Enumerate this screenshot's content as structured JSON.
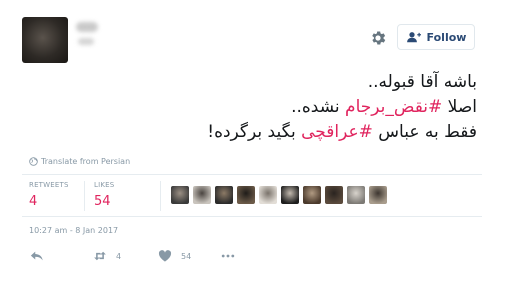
{
  "header": {
    "follow_label": "Follow"
  },
  "tweet": {
    "lines": [
      [
        {
          "text": "باشه آقا قبوله..",
          "hashtag": false
        }
      ],
      [
        {
          "text": "اصلا ",
          "hashtag": false
        },
        {
          "text": "#نقض_برجام",
          "hashtag": true
        },
        {
          "text": " نشده..",
          "hashtag": false
        }
      ],
      [
        {
          "text": "فقط به عباس ",
          "hashtag": false
        },
        {
          "text": "#عراقچی",
          "hashtag": true
        },
        {
          "text": " بگید برگرده!",
          "hashtag": false
        }
      ]
    ],
    "translate_label": "Translate from Persian"
  },
  "stats": {
    "retweets_label": "RETWEETS",
    "retweets_value": "4",
    "likes_label": "LIKES",
    "likes_value": "54"
  },
  "timestamp": "10:27 am - 8 Jan 2017",
  "actions": {
    "retweet_count": "4",
    "like_count": "54"
  },
  "colors": {
    "accent": "#e0245e",
    "muted": "#8899a6",
    "follow_text": "#2b4a75"
  },
  "liker_avatars": [
    {
      "name": "liker-avatar-1",
      "icon": "avatar"
    },
    {
      "name": "liker-avatar-2",
      "icon": "avatar"
    },
    {
      "name": "liker-avatar-3",
      "icon": "avatar"
    },
    {
      "name": "liker-avatar-4",
      "icon": "avatar"
    },
    {
      "name": "liker-avatar-5",
      "icon": "avatar"
    },
    {
      "name": "liker-avatar-6",
      "icon": "avatar"
    },
    {
      "name": "liker-avatar-7",
      "icon": "avatar"
    },
    {
      "name": "liker-avatar-8",
      "icon": "avatar"
    },
    {
      "name": "liker-avatar-9",
      "icon": "avatar"
    },
    {
      "name": "liker-avatar-10",
      "icon": "avatar"
    }
  ]
}
